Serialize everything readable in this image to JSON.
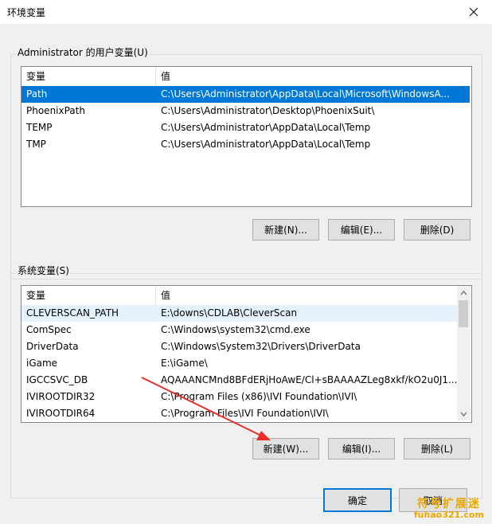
{
  "window": {
    "title": "环境变量"
  },
  "user_vars": {
    "group_label": "Administrator 的用户变量(U)",
    "col_var": "变量",
    "col_val": "值",
    "rows": [
      {
        "name": "Path",
        "value": "C:\\Users\\Administrator\\AppData\\Local\\Microsoft\\WindowsA...",
        "selected": true
      },
      {
        "name": "PhoenixPath",
        "value": "C:\\Users\\Administrator\\Desktop\\PhoenixSuit\\"
      },
      {
        "name": "TEMP",
        "value": "C:\\Users\\Administrator\\AppData\\Local\\Temp"
      },
      {
        "name": "TMP",
        "value": "C:\\Users\\Administrator\\AppData\\Local\\Temp"
      }
    ],
    "btn_new": "新建(N)...",
    "btn_edit": "编辑(E)...",
    "btn_delete": "删除(D)"
  },
  "sys_vars": {
    "group_label": "系统变量(S)",
    "col_var": "变量",
    "col_val": "值",
    "rows": [
      {
        "name": "CLEVERSCAN_PATH",
        "value": "E:\\downs\\CDLAB\\CleverScan",
        "highlighted": true
      },
      {
        "name": "ComSpec",
        "value": "C:\\Windows\\system32\\cmd.exe"
      },
      {
        "name": "DriverData",
        "value": "C:\\Windows\\System32\\Drivers\\DriverData"
      },
      {
        "name": "iGame",
        "value": "E:\\iGame\\"
      },
      {
        "name": "IGCCSVC_DB",
        "value": "AQAAANCMnd8BFdERjHoAwE/Cl+sBAAAAZLeg8xkf/kO2u0J1..."
      },
      {
        "name": "IVIROOTDIR32",
        "value": "C:\\Program Files (x86)\\IVI Foundation\\IVI\\"
      },
      {
        "name": "IVIROOTDIR64",
        "value": "C:\\Program Files\\IVI Foundation\\IVI\\"
      }
    ],
    "btn_new": "新建(W)...",
    "btn_edit": "编辑(I)...",
    "btn_delete": "删除(L)"
  },
  "footer": {
    "ok": "确定",
    "cancel": "取消"
  },
  "watermark": {
    "line1": "符号扩展迷",
    "line2": "fuhao321.com"
  },
  "colors": {
    "selection": "#0078d7",
    "annotation_arrow": "#e8302a",
    "watermark": "#e8a800"
  }
}
